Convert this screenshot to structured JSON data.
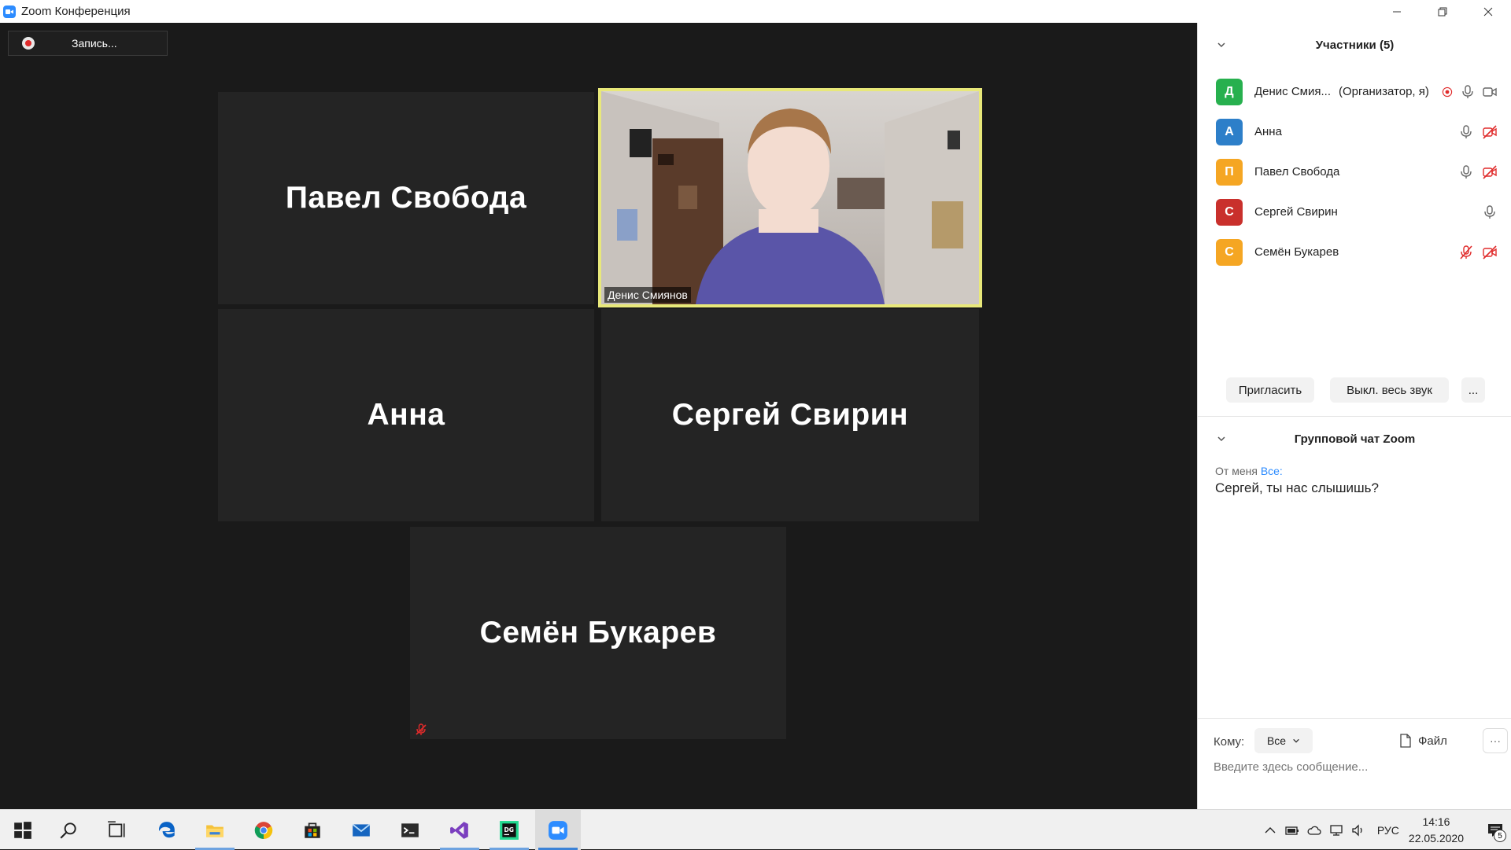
{
  "window": {
    "title": "Zoom Конференция"
  },
  "recording": {
    "label": "Запись..."
  },
  "tiles": [
    {
      "name": "Павел Свобода"
    },
    {
      "name": "Денис Смиянов",
      "video": true
    },
    {
      "name": "Анна"
    },
    {
      "name": "Сергей Свирин"
    },
    {
      "name": "Семён Букарев",
      "muted": true
    }
  ],
  "participants_panel": {
    "title": "Участники (5)",
    "participants": [
      {
        "initial": "Д",
        "name": "Денис Смия...",
        "role": "(Организатор, я)",
        "color": "#27b04e",
        "recording": true,
        "mic": "on",
        "video": "on"
      },
      {
        "initial": "А",
        "name": "Анна",
        "role": "",
        "color": "#2d7fc9",
        "mic": "on",
        "video": "off"
      },
      {
        "initial": "П",
        "name": "Павел Свобода",
        "role": "",
        "color": "#f5a623",
        "mic": "on",
        "video": "off"
      },
      {
        "initial": "С",
        "name": "Сергей Свирин",
        "role": "",
        "color": "#c9302c",
        "mic": "on",
        "video": "none"
      },
      {
        "initial": "С",
        "name": "Семён Букарев",
        "role": "",
        "color": "#f5a623",
        "mic": "muted",
        "video": "off"
      }
    ],
    "buttons": {
      "invite": "Пригласить",
      "mute_all": "Выкл. весь звук",
      "more": "..."
    }
  },
  "chat": {
    "title": "Групповой чат Zoom",
    "messages": [
      {
        "from": "От меня",
        "to": "Все:",
        "text": "Сергей, ты нас слышишь?"
      }
    ],
    "compose": {
      "to_label": "Кому:",
      "to_value": "Все",
      "file_label": "Файл",
      "more_label": "···",
      "placeholder": "Введите здесь сообщение..."
    }
  },
  "taskbar": {
    "apps": [
      "windows-start",
      "search",
      "task-view",
      "edge",
      "file-explorer",
      "chrome",
      "store",
      "mail",
      "terminal",
      "visual-studio",
      "datagrip",
      "zoom"
    ],
    "language": "РУС",
    "time": "14:16",
    "date": "22.05.2020",
    "notifications": "5"
  },
  "colors": {
    "accent": "#2d8cff",
    "active_speaker_border": "#e8e87a",
    "muted_red": "#e02b2b"
  }
}
